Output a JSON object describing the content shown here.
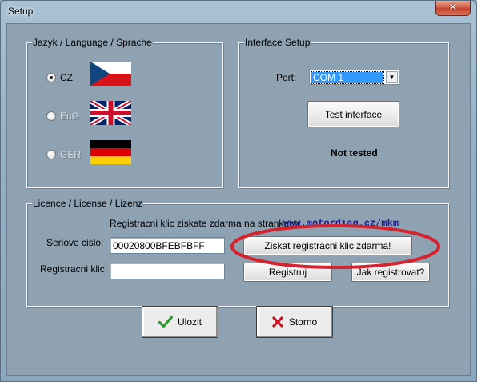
{
  "window": {
    "title": "Setup",
    "close_glyph": "✕"
  },
  "language_group": {
    "label": "Jazyk / Language / Sprache",
    "options": [
      {
        "label": "CZ",
        "checked": true,
        "enabled": true,
        "flag": "czech-flag"
      },
      {
        "label": "EnG",
        "checked": false,
        "enabled": false,
        "flag": "uk-flag"
      },
      {
        "label": "GER",
        "checked": false,
        "enabled": false,
        "flag": "german-flag"
      }
    ]
  },
  "interface_group": {
    "label": "Interface Setup",
    "port_label": "Port:",
    "port_value": "COM 1",
    "test_button": "Test interface",
    "status": "Not tested"
  },
  "licence_group": {
    "label": "Licence / License / Lizenz",
    "info_text": "Registracni klic ziskate zdarma na strankach",
    "url": "www.motordiag.cz/mkm",
    "serial_label": "Seriove cislo:",
    "serial_value": "00020800BFEBFBFF",
    "get_key_button": "Ziskat registracni klic zdarma!",
    "reg_key_label": "Registracni klic:",
    "reg_key_value": "",
    "register_button": "Registruj",
    "how_register_button": "Jak registrovat?"
  },
  "footer": {
    "save_button": "Ulozit",
    "cancel_button": "Storno"
  },
  "colors": {
    "highlight_ellipse": "#d6242f",
    "combo_selection": "#3399ff",
    "link": "#1a1a8c"
  }
}
